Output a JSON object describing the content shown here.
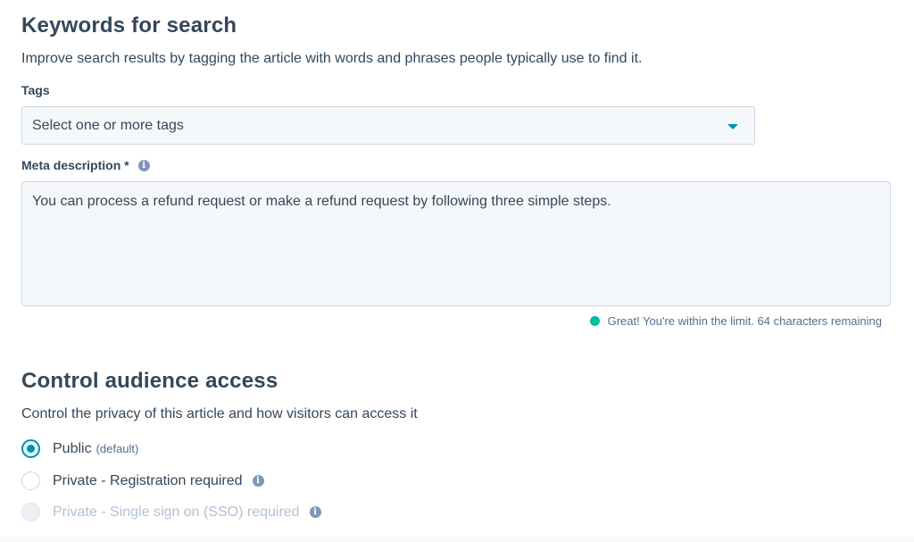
{
  "keywords": {
    "title": "Keywords for search",
    "description": "Improve search results by tagging the article with words and phrases people typically use to find it.",
    "tags_label": "Tags",
    "tags_placeholder": "Select one or more tags",
    "meta_label": "Meta description *",
    "meta_value": "You can process a refund request or make a refund request by following three simple steps.",
    "helper_text": "Great! You're within the limit. 64 characters remaining"
  },
  "access": {
    "title": "Control audience access",
    "description": "Control the privacy of this article and how visitors can access it",
    "options": [
      {
        "label": "Public",
        "note": "(default)",
        "selected": true,
        "disabled": false
      },
      {
        "label": "Private - Registration required",
        "selected": false,
        "disabled": false
      },
      {
        "label": "Private - Single sign on (SSO) required",
        "selected": false,
        "disabled": true
      }
    ]
  },
  "colors": {
    "accent": "#0091ae",
    "success": "#00bda5",
    "text": "#33475b"
  },
  "icons": {
    "info": "info-icon",
    "caret": "chevron-down-icon"
  }
}
